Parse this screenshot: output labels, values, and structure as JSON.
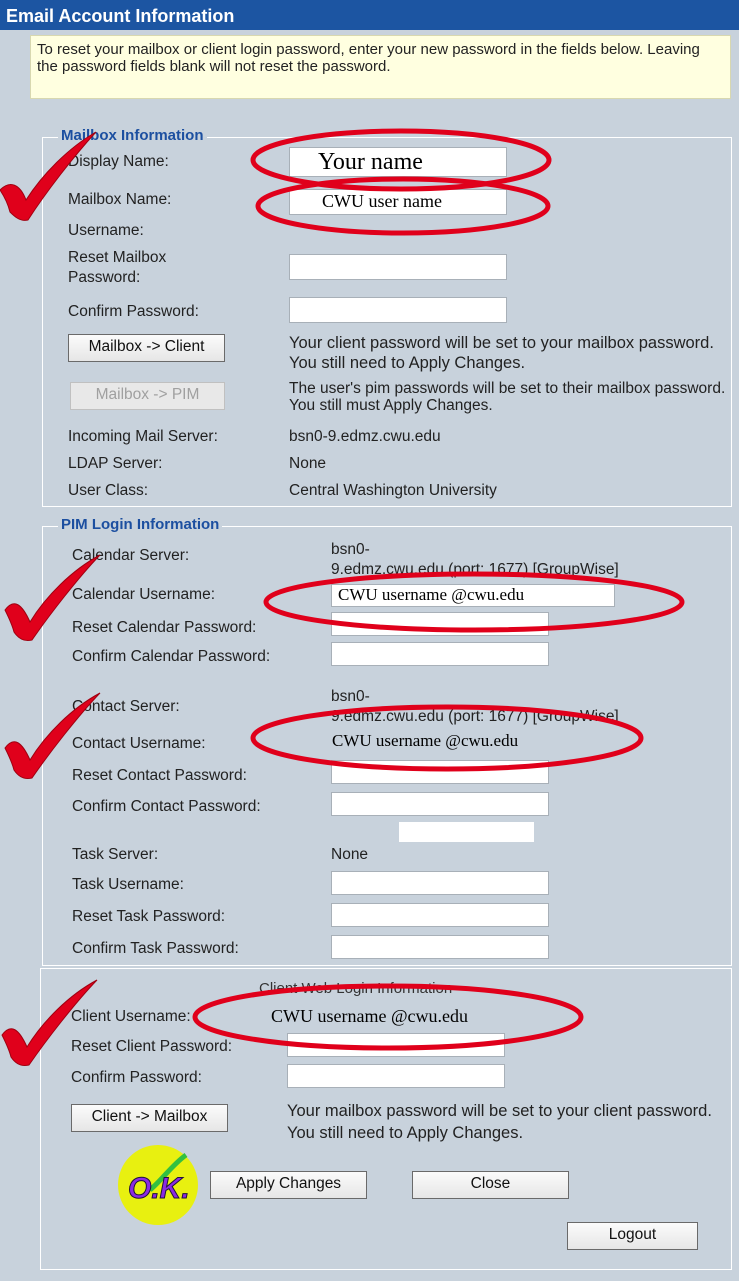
{
  "header": {
    "title": "Email Account Information"
  },
  "intro": {
    "text": "To reset your mailbox or client login password, enter your new password in the fields below. Leaving the password fields blank will not reset the password."
  },
  "mailbox": {
    "legend": "Mailbox Information",
    "display_name_label": "Display Name:",
    "display_name_value": "Your name",
    "mailbox_name_label": "Mailbox Name:",
    "mailbox_name_value": "CWU user name",
    "username_label": "Username:",
    "reset_password_label": "Reset Mailbox Password:",
    "confirm_password_label": "Confirm Password:",
    "mailbox_client_button": "Mailbox -> Client",
    "mailbox_client_note": "Your client password will be set to your mailbox password. You still need to Apply Changes.",
    "mailbox_pim_button": "Mailbox -> PIM",
    "mailbox_pim_note": "The user's pim passwords will be set to their mailbox password. You still must Apply Changes.",
    "incoming_label": "Incoming Mail Server:",
    "incoming_value": "bsn0-9.edmz.cwu.edu",
    "ldap_label": "LDAP Server:",
    "ldap_value": "None",
    "user_class_label": "User Class:",
    "user_class_value": "Central Washington University"
  },
  "pim": {
    "legend": "PIM Login Information",
    "calendar_server_label": "Calendar Server:",
    "calendar_server_value_1": "bsn0-",
    "calendar_server_value_2": "9.edmz.cwu.edu (port: 1677) [GroupWise]",
    "calendar_username_label": "Calendar Username:",
    "calendar_username_value": "CWU username @cwu.edu",
    "reset_calendar_label": "Reset Calendar Password:",
    "confirm_calendar_label": "Confirm Calendar Password:",
    "contact_server_label": "Contact Server:",
    "contact_server_value_1": "bsn0-",
    "contact_server_value_2": "9.edmz.cwu.edu (port: 1677) [GroupWise]",
    "contact_username_label": "Contact Username:",
    "contact_username_value": "CWU username @cwu.edu",
    "reset_contact_label": "Reset Contact Password:",
    "confirm_contact_label": "Confirm Contact Password:",
    "task_server_label": "Task Server:",
    "task_server_value": "None",
    "task_username_label": "Task Username:",
    "reset_task_label": "Reset Task Password:",
    "confirm_task_label": "Confirm Task Password:"
  },
  "client_web": {
    "legend": "Client Web Login Information",
    "client_username_label": "Client Username:",
    "client_username_value": "CWU username @cwu.edu",
    "reset_client_label": "Reset Client Password:",
    "confirm_label": "Confirm Password:",
    "client_mailbox_button": "Client -> Mailbox",
    "client_mailbox_note": "Your mailbox password will be set to your client password. You still need to Apply Changes."
  },
  "actions": {
    "apply_label": "Apply Changes",
    "close_label": "Close",
    "logout_label": "Logout",
    "ok_badge": "O.K."
  },
  "colors": {
    "header_bg": "#1c55a2",
    "panel_bg": "#c8d2dc",
    "annotation_red": "#e0001b",
    "legend_blue": "#1c4fa0"
  },
  "icons": {
    "check": "checkmark-icon",
    "ok": "ok-badge-icon"
  }
}
